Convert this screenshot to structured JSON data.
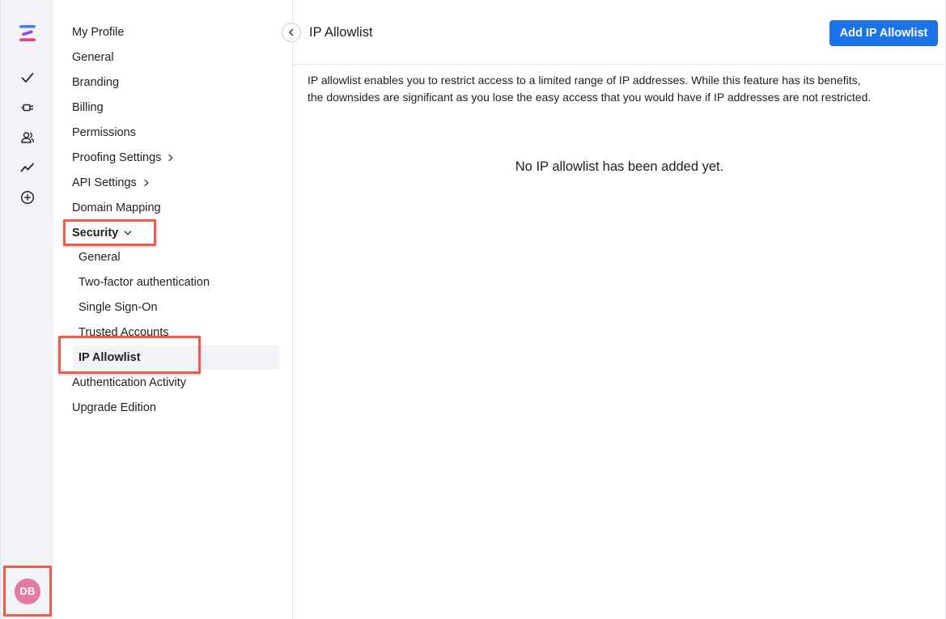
{
  "rail": {
    "icons": [
      "logo-icon",
      "check-icon",
      "plug-icon",
      "users-icon",
      "analytics-icon",
      "add-circle-icon"
    ],
    "avatar_initials": "DB"
  },
  "nav": {
    "items": [
      {
        "label": "My Profile"
      },
      {
        "label": "General"
      },
      {
        "label": "Branding"
      },
      {
        "label": "Billing"
      },
      {
        "label": "Permissions"
      },
      {
        "label": "Proofing Settings"
      },
      {
        "label": "API Settings"
      },
      {
        "label": "Domain Mapping"
      },
      {
        "label": "Security"
      },
      {
        "label": "Authentication Activity"
      },
      {
        "label": "Upgrade Edition"
      }
    ],
    "security_sub": [
      {
        "label": "General"
      },
      {
        "label": "Two-factor authentication"
      },
      {
        "label": "Single Sign-On"
      },
      {
        "label": "Trusted Accounts"
      },
      {
        "label": "IP Allowlist"
      }
    ]
  },
  "main": {
    "title": "IP Allowlist",
    "add_button": "Add IP Allowlist",
    "description_line1": "IP allowlist enables you to restrict access to a limited range of IP addresses. While this feature has its benefits,",
    "description_line2": "the downsides are significant as you lose the easy access that you would have if IP addresses are not restricted.",
    "empty_message": "No IP allowlist has been added yet."
  },
  "colors": {
    "accent": "#1a73e8",
    "highlight": "#ef5b4c",
    "avatar": "#e27aa3",
    "rail_bg": "#f2f3f7"
  }
}
